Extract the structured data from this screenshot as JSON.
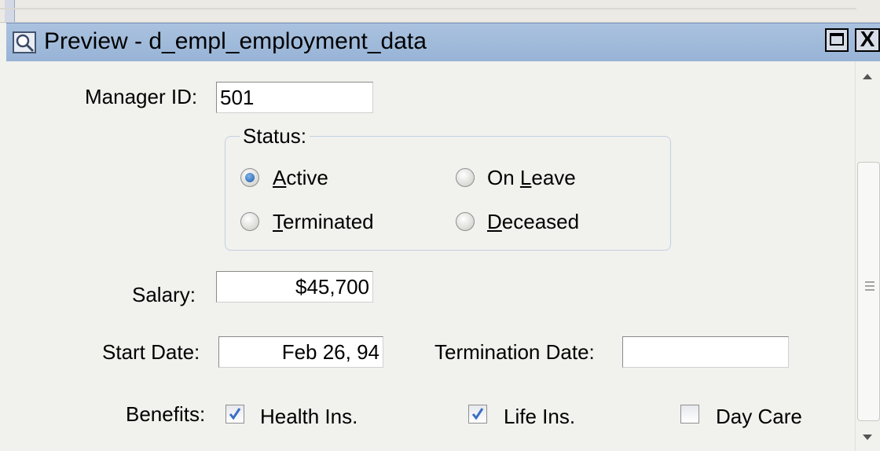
{
  "window": {
    "title": "Preview - d_empl_employment_data",
    "icons": {
      "app": "preview-icon",
      "maximize": "maximize-icon",
      "close": "close-icon"
    },
    "close_glyph": "X"
  },
  "form": {
    "manager": {
      "label": "Manager ID:",
      "value": "501"
    },
    "status": {
      "title": "Status:",
      "options": [
        {
          "pre": "",
          "key": "A",
          "post": "ctive",
          "selected": true
        },
        {
          "pre": "On ",
          "key": "L",
          "post": "eave",
          "selected": false
        },
        {
          "pre": "",
          "key": "T",
          "post": "erminated",
          "selected": false
        },
        {
          "pre": "",
          "key": "D",
          "post": "eceased",
          "selected": false
        }
      ]
    },
    "salary": {
      "label": "Salary:",
      "value": "$45,700"
    },
    "start_date": {
      "label": "Start Date:",
      "value": "Feb 26, 94"
    },
    "termination_date": {
      "label": "Termination Date:",
      "value": ""
    },
    "benefits": {
      "label": "Benefits:",
      "items": [
        {
          "label": "Health Ins.",
          "checked": true
        },
        {
          "label": "Life Ins.",
          "checked": true
        },
        {
          "label": "Day Care",
          "checked": false
        }
      ]
    }
  },
  "colors": {
    "titlebar": "#9fb9da",
    "radio_selected": "#1d5aa8",
    "check": "#3b6fc4"
  }
}
